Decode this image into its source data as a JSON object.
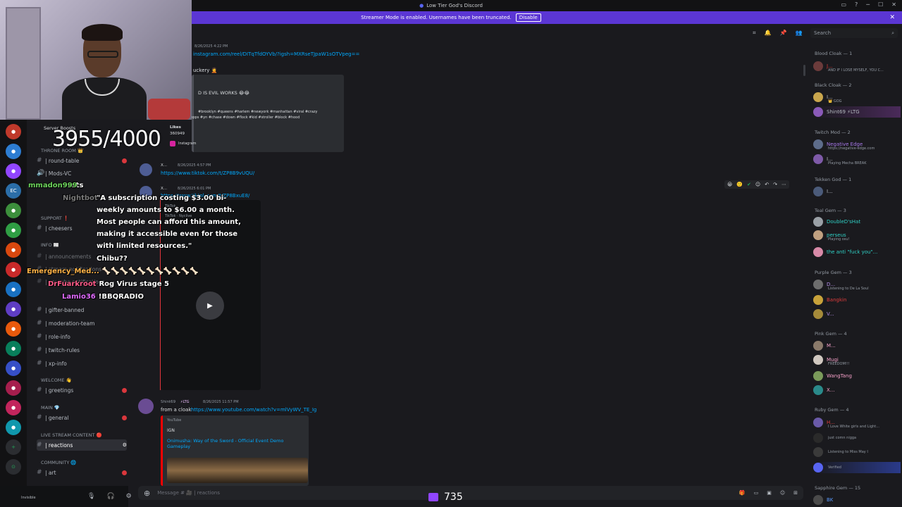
{
  "titlebar": {
    "title": "Low Tier God's Discord"
  },
  "banner": {
    "text": "Streamer Mode is enabled. Usernames have been truncated.",
    "disable": "Disable",
    "close": "✕"
  },
  "header": {
    "search_placeholder": "Search"
  },
  "stream_overlay": {
    "sub_count": "3955/4000",
    "viewer_count": "735",
    "chat": [
      {
        "user": "",
        "text": "rats"
      },
      {
        "user": "",
        "text": "\"A subscription costing $3.00 bi-"
      },
      {
        "user": "",
        "text": "weekly amounts to $6.00 a month."
      },
      {
        "user": "",
        "text": "Most people can afford this amount,"
      },
      {
        "user": "",
        "text": "making it accessible even for those"
      },
      {
        "user": "",
        "text": "with limited resources.\""
      },
      {
        "user": "",
        "text": "Chibu??"
      },
      {
        "user": "Emergency_Med...",
        "text": "🦴🦴🦴🦴🦴🦴🦴🦴🦴🦴🦴"
      },
      {
        "user": "DrFuarkroot",
        "text": "Rog Virus stage 5"
      },
      {
        "user": "Lamio36",
        "text": "!BBQRADIO"
      },
      {
        "user": "mmadon999",
        "text": ""
      },
      {
        "user": "Nightbot",
        "text": ""
      }
    ]
  },
  "sidebar": {
    "server_boosts": "Server Boosts",
    "categories": [
      {
        "label": "THRONE ROOM 👑"
      },
      {
        "label": "SUPPORT ❗"
      },
      {
        "label": "INFO 📰"
      },
      {
        "label": "WELCOME 👋"
      },
      {
        "label": "MAIN 💎"
      },
      {
        "label": "LIVE STREAM CONTENT 🔴"
      },
      {
        "label": "COMMUNITY 🌐"
      }
    ],
    "channels": [
      {
        "label": "| round-table"
      },
      {
        "label": "| Mods-VC"
      },
      {
        "label": "| cheesers"
      },
      {
        "label": "| announcements"
      },
      {
        "label": "| stream-notifications"
      },
      {
        "label": "| youtube-notifications"
      },
      {
        "label": "| gifter-banned"
      },
      {
        "label": "| moderation-team"
      },
      {
        "label": "| role-info"
      },
      {
        "label": "| twitch-rules"
      },
      {
        "label": "| xp-info"
      },
      {
        "label": "| greetings"
      },
      {
        "label": "| general"
      },
      {
        "label": "| reactions"
      },
      {
        "label": "| art"
      }
    ],
    "user_status": "Invisible"
  },
  "messages": {
    "m1_time": "8/26/2025 4:22 PM",
    "m1_link": "instagram.com/reel/DITqTfdOYVb/?igsh=MXRseTJpaW1sOTVpeg==",
    "m1_text": "uckery 🤦",
    "m1_embed_title": "D IS EVIL WORKS 😂😂",
    "m1_embed_tags": "#brooklyn #queens #harlem #newyork #manhattan #viral #crazy",
    "m1_embed_tags2": "#movie #opps #yn #chase #down #flock #kid #stroller #block #hood",
    "m1_likes_label": "Likes",
    "m1_likes_value": "360949",
    "m1_provider": "Instagram",
    "m2_user": "X...",
    "m2_time": "8/26/2025 4:57 PM",
    "m2_link": "https://www.tiktok.com/t/ZP8B9vUQU/",
    "m3_user": "X...",
    "m3_time": "8/26/2025 6:01 PM",
    "m3_link": "https://www.tiktok.com/t/ZP8BxuE8/",
    "m3_embed_provider": "TikTok",
    "m3_embed_author": "TikTok · Nyclive",
    "m4_user": "Shint69",
    "m4_tag": "⚡LTG",
    "m4_time": "8/26/2025 11:57 PM",
    "m4_prefix": "from a cloak",
    "m4_link": "https://www.youtube.com/watch?v=mlVyWV_TE_Ig",
    "m4_embed_provider": "YouTube",
    "m4_embed_author": "IGN",
    "m4_embed_title": "Onimusha: Way of the Sword - Official Event Demo Gameplay"
  },
  "composer": {
    "placeholder": "Message # 🎥 | reactions"
  },
  "members": {
    "groups": [
      {
        "label": "Blood Cloak — 1"
      },
      {
        "label": "Black Cloak — 2"
      },
      {
        "label": "Twitch Mod — 2"
      },
      {
        "label": "Tekken God — 1"
      },
      {
        "label": "Teal Gem — 3"
      },
      {
        "label": "Purple Gem — 3"
      },
      {
        "label": "Pink Gem — 4"
      },
      {
        "label": "Ruby Gem — 4"
      },
      {
        "label": "Sapphire Gem — 15"
      }
    ],
    "list": [
      {
        "name": "J...",
        "status": "AND IF I LOSE MYSELF, YOU C..."
      },
      {
        "name": "I...",
        "status": "👑 GOG"
      },
      {
        "name": "Shint69 ⚡LTG",
        "status": ""
      },
      {
        "name": "Negative Edge",
        "status": "https://negative-edge.com"
      },
      {
        "name": "I...",
        "status": "Playing Mecha BREAK"
      },
      {
        "name": "I...",
        "status": ""
      },
      {
        "name": "DoubleD'sHat",
        "status": ""
      },
      {
        "name": "perseus",
        "status": "Playing osu!"
      },
      {
        "name": "the anti \"fuck you\"...",
        "status": ""
      },
      {
        "name": "D...",
        "status": "Listening to De La Soul"
      },
      {
        "name": "Bangkin",
        "status": ""
      },
      {
        "name": "V...",
        "status": ""
      },
      {
        "name": "M...",
        "status": ""
      },
      {
        "name": "Mugi",
        "status": "FREEDOM!!!"
      },
      {
        "name": "WangTang",
        "status": ""
      },
      {
        "name": "X...",
        "status": ""
      },
      {
        "name": "H...",
        "status": "I Love White girls and Light..."
      },
      {
        "name": "",
        "status": "just comn nigga"
      },
      {
        "name": "",
        "status": "Listening to Miss May I"
      },
      {
        "name": "",
        "status": "Verified"
      },
      {
        "name": "BK",
        "status": ""
      }
    ]
  }
}
